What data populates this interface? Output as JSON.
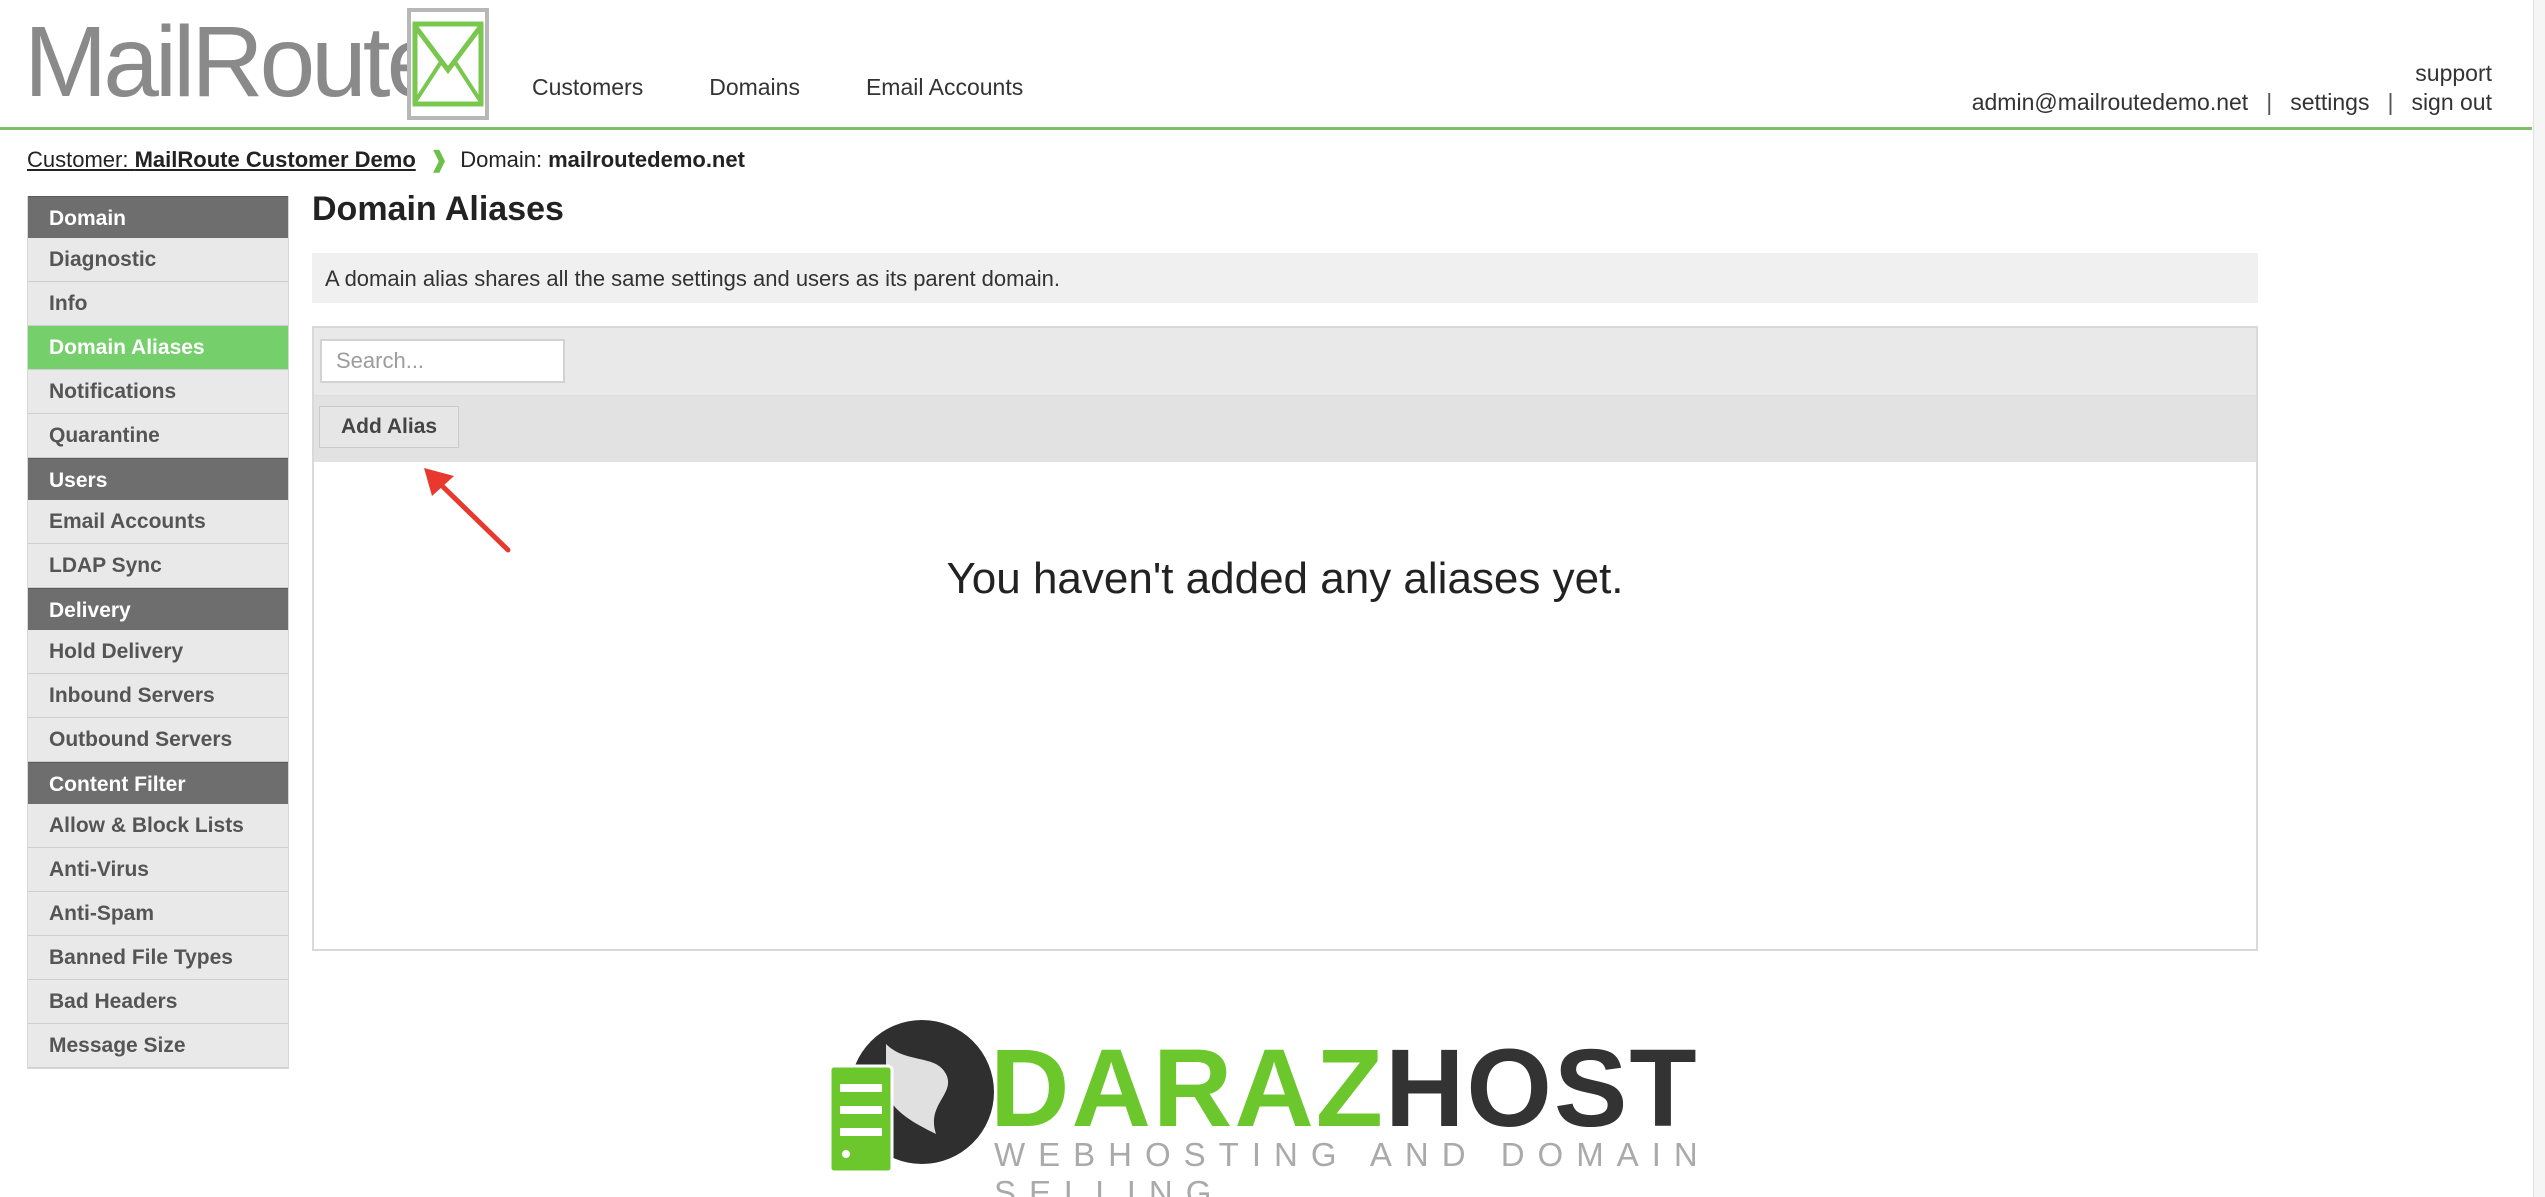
{
  "brand": {
    "logo_text": "MailRoute"
  },
  "topnav": [
    "Customers",
    "Domains",
    "Email Accounts"
  ],
  "usernav": {
    "support": "support",
    "email": "admin@mailroutedemo.net",
    "sep": "|",
    "settings": "settings",
    "signout": "sign out"
  },
  "breadcrumb": {
    "customer_label": "Customer:",
    "customer_name": "MailRoute Customer Demo",
    "chevron": "❱",
    "domain_label": "Domain:",
    "domain_name": "mailroutedemo.net"
  },
  "sidebar": {
    "sections": [
      {
        "title": "Domain",
        "items": [
          "Diagnostic",
          "Info",
          "Domain Aliases",
          "Notifications",
          "Quarantine"
        ]
      },
      {
        "title": "Users",
        "items": [
          "Email Accounts",
          "LDAP Sync"
        ]
      },
      {
        "title": "Delivery",
        "items": [
          "Hold Delivery",
          "Inbound Servers",
          "Outbound Servers"
        ]
      },
      {
        "title": "Content Filter",
        "items": [
          "Allow & Block Lists",
          "Anti-Virus",
          "Anti-Spam",
          "Banned File Types",
          "Bad Headers",
          "Message Size"
        ]
      }
    ],
    "active": "Domain Aliases"
  },
  "main": {
    "title": "Domain Aliases",
    "info": "A domain alias shares all the same settings and users as its parent domain.",
    "search_placeholder": "Search...",
    "add_button": "Add Alias",
    "empty_message": "You haven't added any aliases yet."
  },
  "watermark": {
    "part1": "DARAZ",
    "part2": "HOST",
    "tagline": "WEBHOSTING AND DOMAIN SELLING"
  },
  "colors": {
    "accent_green": "#75cf6b",
    "sidebar_header": "#6e6e6e",
    "arrow_red": "#e8392f"
  }
}
